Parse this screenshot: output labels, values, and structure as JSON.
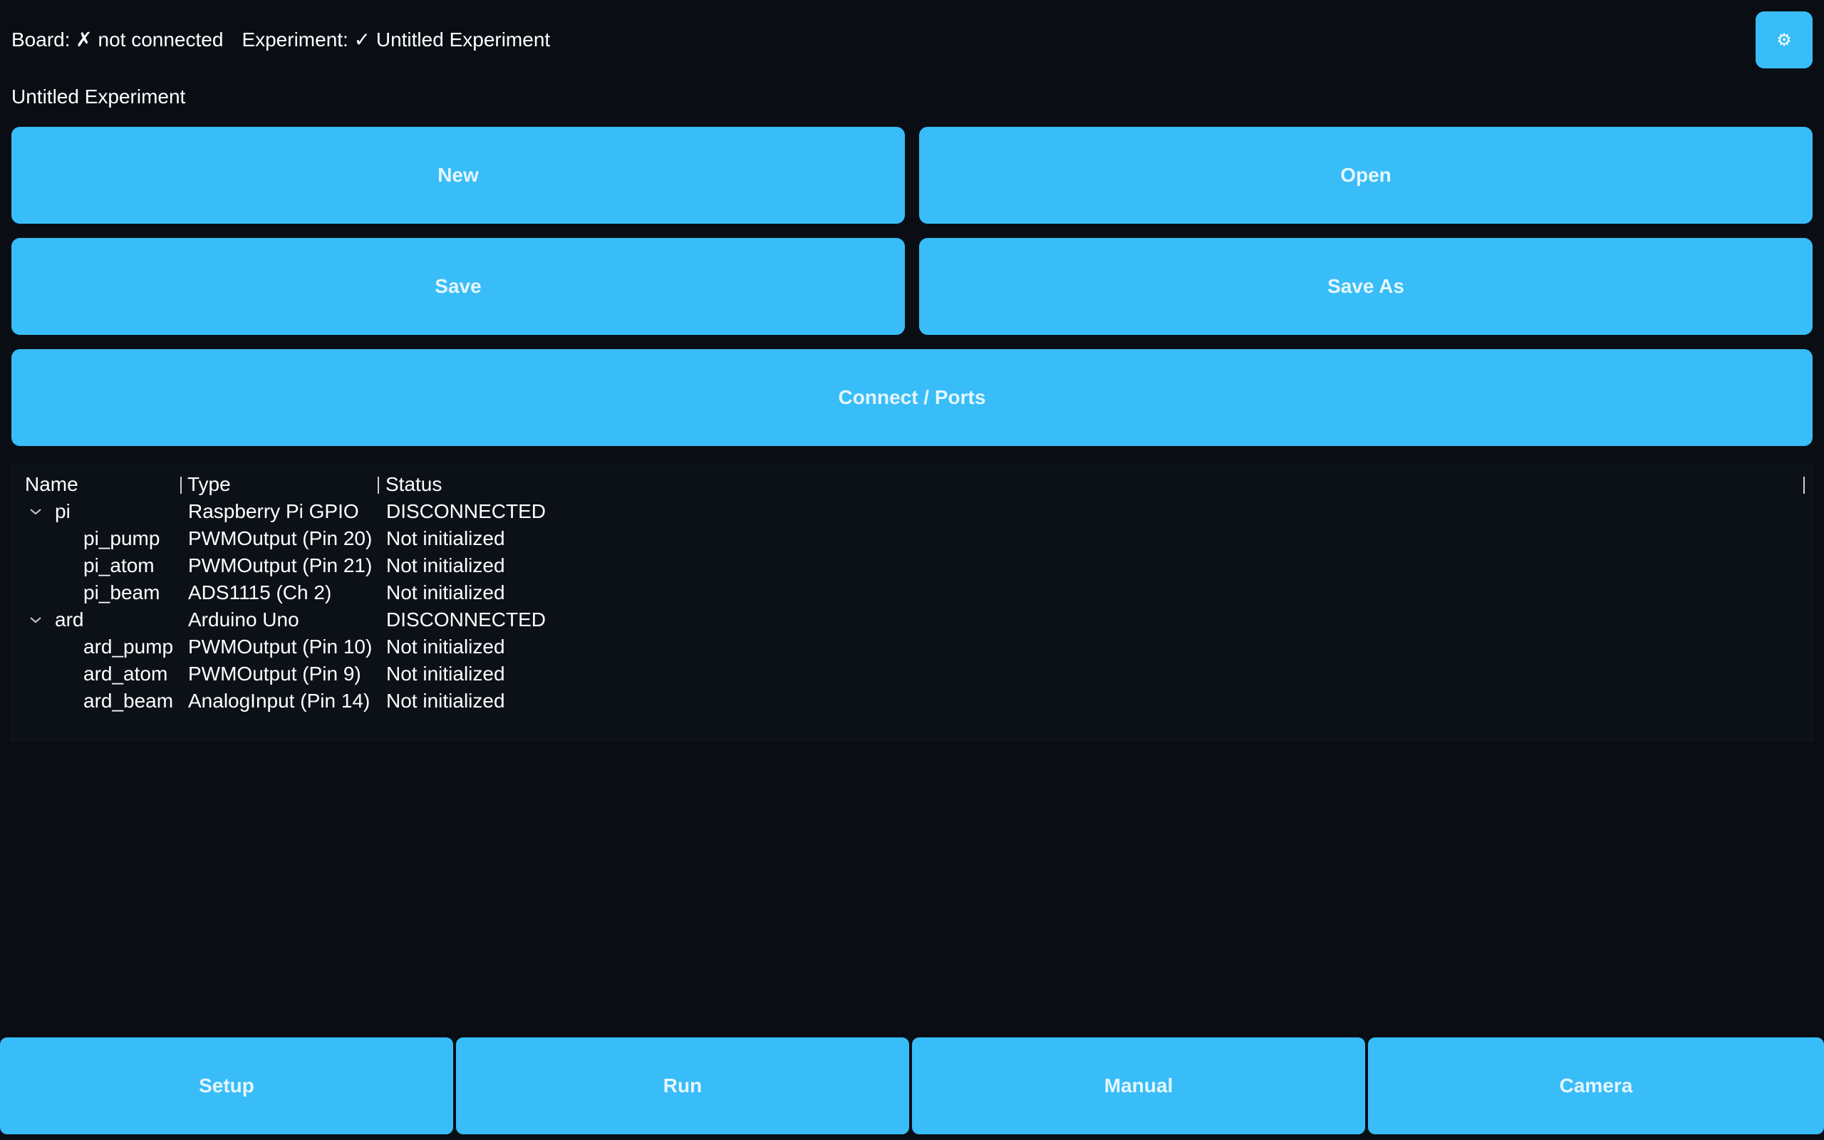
{
  "status": {
    "board": "Board: ✗ not connected",
    "experiment": "Experiment: ✓ Untitled Experiment"
  },
  "settings": {
    "icon": "gear-icon",
    "glyph": "⚙"
  },
  "experiment_name": "Untitled Experiment",
  "actions": {
    "new": "New",
    "open": "Open",
    "save": "Save",
    "save_as": "Save As",
    "connect": "Connect / Ports"
  },
  "tree": {
    "columns": [
      "Name",
      "Type",
      "Status"
    ],
    "rows": [
      {
        "name": "pi",
        "type": "Raspberry Pi GPIO",
        "status": "DISCONNECTED"
      },
      {
        "name": "pi_pump",
        "type": "PWMOutput (Pin 20)",
        "status": "Not initialized"
      },
      {
        "name": "pi_atom",
        "type": "PWMOutput (Pin 21)",
        "status": "Not initialized"
      },
      {
        "name": "pi_beam",
        "type": "ADS1115 (Ch 2)",
        "status": "Not initialized"
      },
      {
        "name": "ard",
        "type": "Arduino Uno",
        "status": "DISCONNECTED"
      },
      {
        "name": "ard_pump",
        "type": "PWMOutput (Pin 10)",
        "status": "Not initialized"
      },
      {
        "name": "ard_atom",
        "type": "PWMOutput (Pin 9)",
        "status": "Not initialized"
      },
      {
        "name": "ard_beam",
        "type": "AnalogInput (Pin 14)",
        "status": "Not initialized"
      }
    ]
  },
  "tabs": {
    "setup": "Setup",
    "run": "Run",
    "manual": "Manual",
    "camera": "Camera"
  },
  "colors": {
    "background": "#0a0e14",
    "accent": "#38bdf8"
  }
}
